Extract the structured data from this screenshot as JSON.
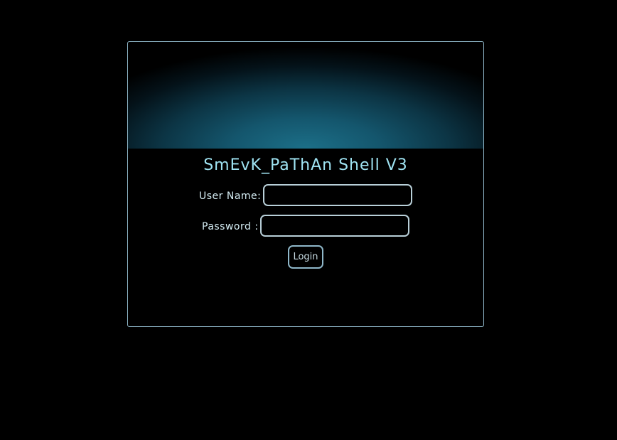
{
  "title": "SmEvK_PaThAn Shell V3",
  "form": {
    "username_label": "User Name:",
    "username_value": "",
    "password_label": "Password :",
    "password_value": "",
    "login_label": "Login"
  },
  "colors": {
    "background": "#000000",
    "title": "#9fe3f2",
    "border": "#8fb7c9",
    "banner_glow": "#1c6f88"
  }
}
